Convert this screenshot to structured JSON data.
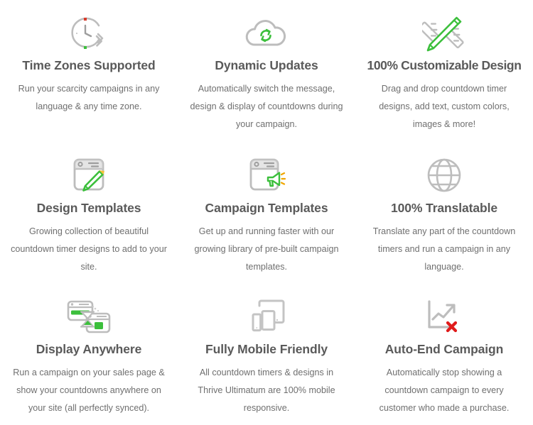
{
  "theme": {
    "accent_green": "#3cbf3c",
    "icon_gray": "#bdbdbd",
    "heading_color": "#5a5a5a",
    "body_color": "#6f6f6f",
    "alert_red": "#e01b1b",
    "background": "#ffffff"
  },
  "features": [
    {
      "icon": "clock-refresh-icon",
      "title": "Time Zones Supported",
      "description": "Run your scarcity campaigns in any language & any time zone."
    },
    {
      "icon": "cloud-sync-icon",
      "title": "Dynamic Updates",
      "description": "Automatically switch the message, design & display of countdowns during your campaign."
    },
    {
      "icon": "pencil-ruler-icon",
      "title": "100% Customizable Design",
      "description": "Drag and drop countdown timer designs, add text, custom colors, images & more!"
    },
    {
      "icon": "browser-pencil-icon",
      "title": "Design Templates",
      "description": "Growing collection of beautiful countdown timer designs to add to your site."
    },
    {
      "icon": "browser-megaphone-icon",
      "title": "Campaign Templates",
      "description": "Get up and running faster with our growing library of pre-built campaign templates."
    },
    {
      "icon": "globe-icon",
      "title": "100% Translatable",
      "description": "Translate any part of the countdown timers and run a campaign in any language."
    },
    {
      "icon": "browser-windows-hourglass-icon",
      "title": "Display Anywhere",
      "description": "Run a campaign on your sales page & show your countdowns anywhere on your site (all perfectly synced)."
    },
    {
      "icon": "responsive-devices-icon",
      "title": "Fully Mobile Friendly",
      "description": "All countdown timers & designs in Thrive Ultimatum are 100% mobile responsive."
    },
    {
      "icon": "chart-arrow-stop-icon",
      "title": "Auto-End Campaign",
      "description": "Automatically stop showing a countdown campaign to every customer who made a purchase."
    }
  ]
}
